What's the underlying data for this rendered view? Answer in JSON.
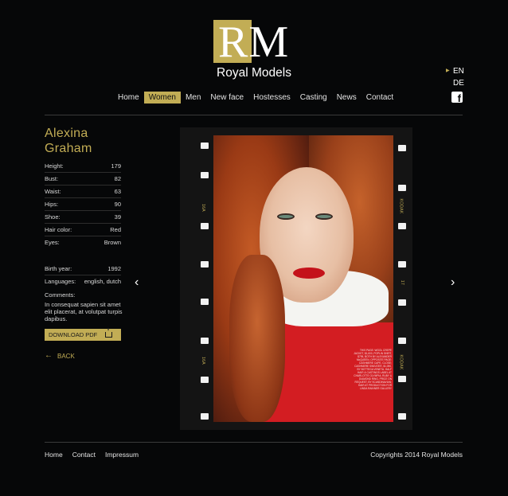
{
  "brand": {
    "initials": "RM",
    "name": "Royal Models"
  },
  "languages": [
    {
      "code": "EN",
      "active": true
    },
    {
      "code": "DE",
      "active": false
    }
  ],
  "social": {
    "icon": "facebook-icon",
    "glyph": "f"
  },
  "nav": [
    {
      "label": "Home",
      "active": false
    },
    {
      "label": "Women",
      "active": true
    },
    {
      "label": "Men",
      "active": false
    },
    {
      "label": "New face",
      "active": false
    },
    {
      "label": "Hostesses",
      "active": false
    },
    {
      "label": "Casting",
      "active": false
    },
    {
      "label": "News",
      "active": false
    },
    {
      "label": "Contact",
      "active": false
    }
  ],
  "model": {
    "first_name": "Alexina",
    "last_name": "Graham",
    "stats": [
      {
        "label": "Height:",
        "value": "179"
      },
      {
        "label": "Bust:",
        "value": "82"
      },
      {
        "label": "Waist:",
        "value": "63"
      },
      {
        "label": "Hips:",
        "value": "90"
      },
      {
        "label": "Shoe:",
        "value": "39"
      },
      {
        "label": "Hair color:",
        "value": "Red"
      },
      {
        "label": "Eyes:",
        "value": "Brown"
      }
    ],
    "details": [
      {
        "label": "Birth year:",
        "value": "1992"
      },
      {
        "label": "Languages:",
        "value": "english, dutch"
      }
    ],
    "comments_label": "Comments:",
    "comments": "In consequat sapien sit amet elit placerat, at volutpat turpis dapibus."
  },
  "actions": {
    "download_pdf": "DOWNLOAD PDF",
    "back": "BACK"
  },
  "gallery": {
    "prev_icon": "chevron-left-icon",
    "next_icon": "chevron-right-icon",
    "film_labels": {
      "left_top": "16A",
      "left_bottom": "16A",
      "right_top": "KODAK",
      "right_bottom": "KODAK",
      "right_mid": "17"
    },
    "photo_credits": "THIS PAGE: WOOL CREPE JACKET, $1,600, POPLIN SHIRT, $795, BOTH BY ALEXANDER McQUEEN. OPPOSITE PAGE: CASHMERE CAPE, CLOSE; CASHMERE SWEATER, $1,090, BY BOTTEGA VENETA. HALF HAIR & CASTINGS LABEL AT CHARLOTTE OLYMPIA; RUBY & DIAMOND RING, PRICE ON REQUEST, BY SCANDINAVIAN; HAIR AT PRODUCTION FOR LINDA RAINNER GALLERY"
  },
  "footer": {
    "links": [
      "Home",
      "Contact",
      "Impressum"
    ],
    "copyright": "Copyrights 2014 Royal Models"
  },
  "colors": {
    "background": "#060708",
    "accent_gold": "#c2ad55",
    "text": "#e9e9e9"
  }
}
